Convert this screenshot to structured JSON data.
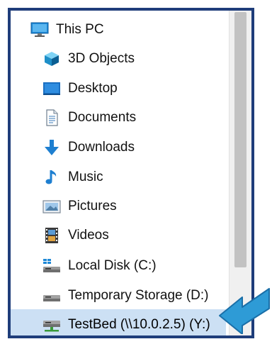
{
  "nav": {
    "items": [
      {
        "label": "This PC",
        "icon": "pc-icon",
        "indent": false,
        "selected": false
      },
      {
        "label": "3D Objects",
        "icon": "3d-objects-icon",
        "indent": true,
        "selected": false
      },
      {
        "label": "Desktop",
        "icon": "desktop-icon",
        "indent": true,
        "selected": false
      },
      {
        "label": "Documents",
        "icon": "documents-icon",
        "indent": true,
        "selected": false
      },
      {
        "label": "Downloads",
        "icon": "downloads-icon",
        "indent": true,
        "selected": false
      },
      {
        "label": "Music",
        "icon": "music-icon",
        "indent": true,
        "selected": false
      },
      {
        "label": "Pictures",
        "icon": "pictures-icon",
        "indent": true,
        "selected": false
      },
      {
        "label": "Videos",
        "icon": "videos-icon",
        "indent": true,
        "selected": false
      },
      {
        "label": "Local Disk (C:)",
        "icon": "local-disk-icon",
        "indent": true,
        "selected": false
      },
      {
        "label": "Temporary Storage (D:)",
        "icon": "drive-icon",
        "indent": true,
        "selected": false
      },
      {
        "label": "TestBed (\\\\10.0.2.5) (Y:)",
        "icon": "network-drive-icon",
        "indent": true,
        "selected": true
      }
    ]
  },
  "scrollbar": {
    "down_arrow": "⌄"
  },
  "colors": {
    "frame_border": "#1f3d7a",
    "selected_bg": "#cce0f4",
    "callout_arrow": "#2e9bd6"
  }
}
